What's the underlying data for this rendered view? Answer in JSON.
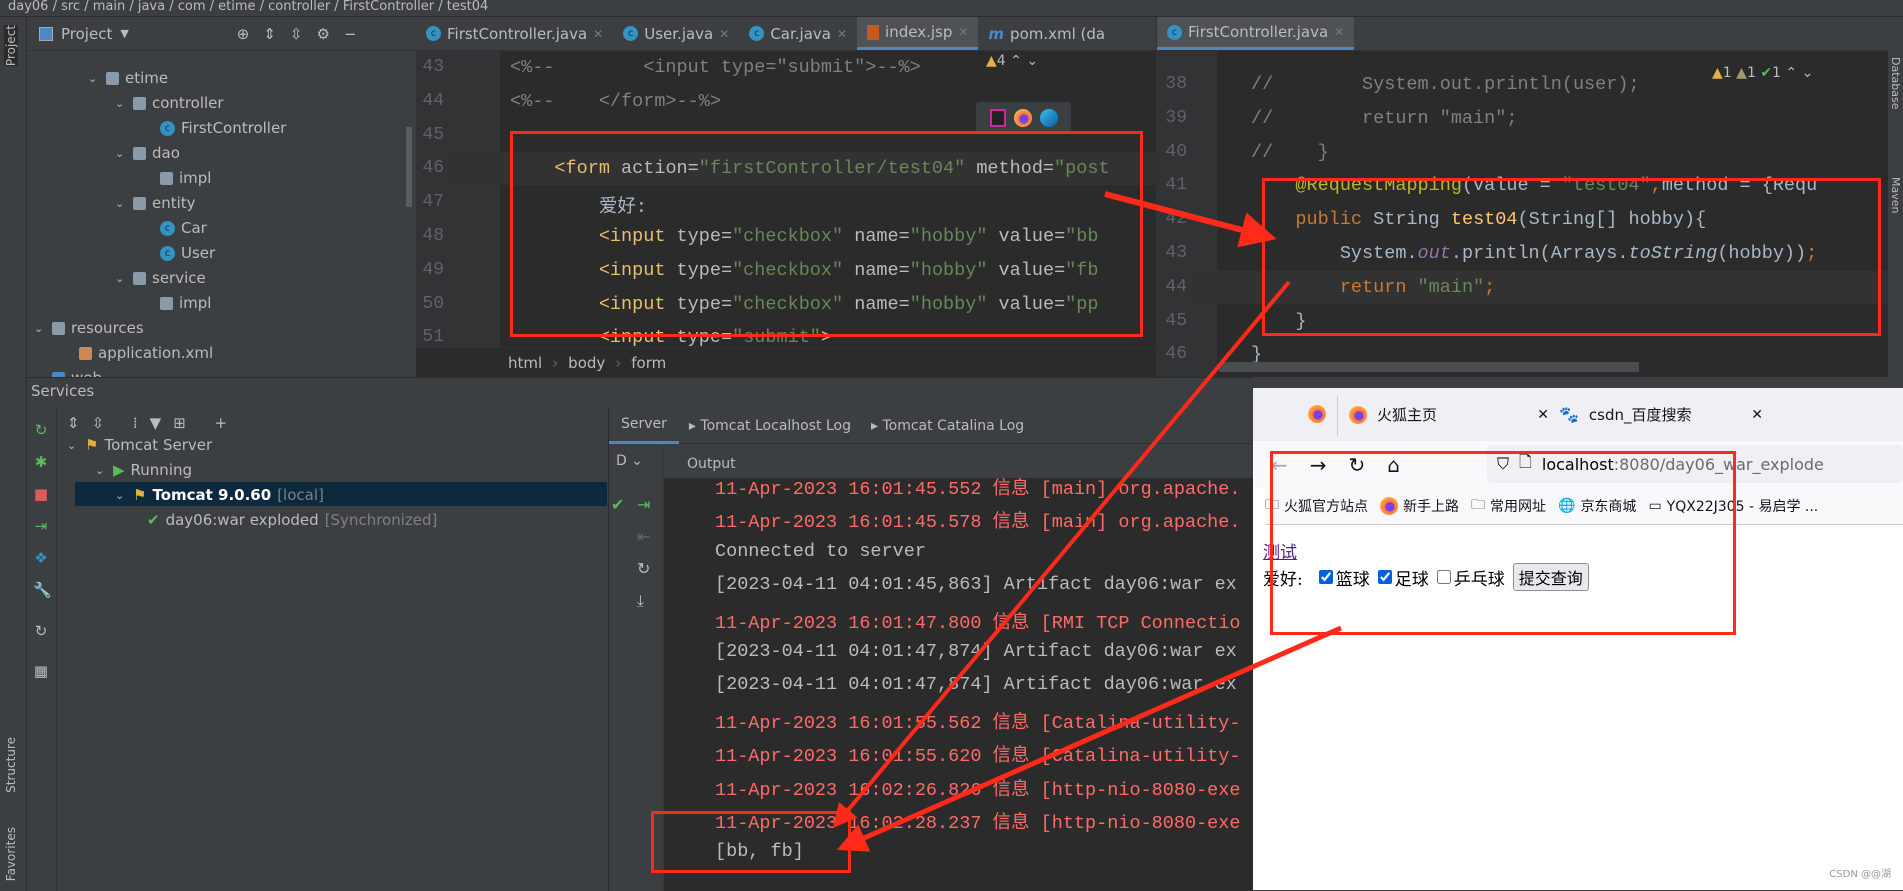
{
  "breadcrumb": "day06 / src / main / java / com / etime / controller / FirstController / test04",
  "left_strip": {
    "project": "Project",
    "structure": "Structure",
    "favorites": "Favorites"
  },
  "right_strip": {
    "database": "Database",
    "maven": "Maven"
  },
  "run_config": "Tomcat 9.0.60",
  "project_panel": {
    "title": "Project",
    "tree": [
      {
        "label": "etime",
        "type": "package",
        "level": 3,
        "expanded": true
      },
      {
        "label": "controller",
        "type": "package",
        "level": 4,
        "expanded": true
      },
      {
        "label": "FirstController",
        "type": "class",
        "level": 5
      },
      {
        "label": "dao",
        "type": "package",
        "level": 4,
        "expanded": true
      },
      {
        "label": "impl",
        "type": "package",
        "level": 5
      },
      {
        "label": "entity",
        "type": "package",
        "level": 4,
        "expanded": true
      },
      {
        "label": "Car",
        "type": "class",
        "level": 5
      },
      {
        "label": "User",
        "type": "class",
        "level": 5
      },
      {
        "label": "service",
        "type": "package",
        "level": 4,
        "expanded": true
      },
      {
        "label": "impl",
        "type": "package",
        "level": 5
      },
      {
        "label": "resources",
        "type": "folder",
        "level": 1,
        "expanded": true
      },
      {
        "label": "application.xml",
        "type": "xml",
        "level": 2
      },
      {
        "label": "web",
        "type": "folder",
        "level": 1,
        "expanded": true
      }
    ]
  },
  "editor_left": {
    "tabs": [
      {
        "label": "FirstController.java",
        "icon": "class-icon",
        "active": false
      },
      {
        "label": "User.java",
        "icon": "class-icon",
        "active": false
      },
      {
        "label": "Car.java",
        "icon": "class-icon",
        "active": false
      },
      {
        "label": "index.jsp",
        "icon": "jsp-icon",
        "active": true
      },
      {
        "label": "pom.xml (da",
        "icon": "maven-icon",
        "active": false
      }
    ],
    "warnings": "4",
    "lines": [
      {
        "n": "43",
        "tokens": [
          [
            "<%--        <input type=\"submit\">--%>",
            "com"
          ]
        ]
      },
      {
        "n": "44",
        "tokens": [
          [
            "<%--    </form>--%>",
            "com"
          ]
        ]
      },
      {
        "n": "45",
        "tokens": []
      },
      {
        "n": "46",
        "tokens": [
          [
            "    ",
            "txt"
          ],
          [
            "<form",
            "tag"
          ],
          [
            " action=",
            "attr"
          ],
          [
            "\"firstController/test04\"",
            "val"
          ],
          [
            " method=",
            "attr"
          ],
          [
            "\"post",
            "val"
          ]
        ]
      },
      {
        "n": "47",
        "tokens": [
          [
            "        爱好:",
            "txt"
          ]
        ]
      },
      {
        "n": "48",
        "tokens": [
          [
            "        ",
            "txt"
          ],
          [
            "<input",
            "tag"
          ],
          [
            " type=",
            "attr"
          ],
          [
            "\"checkbox\"",
            "val"
          ],
          [
            " name=",
            "attr"
          ],
          [
            "\"hobby\"",
            "val"
          ],
          [
            " value=",
            "attr"
          ],
          [
            "\"bb",
            "val"
          ]
        ]
      },
      {
        "n": "49",
        "tokens": [
          [
            "        ",
            "txt"
          ],
          [
            "<input",
            "tag"
          ],
          [
            " type=",
            "attr"
          ],
          [
            "\"checkbox\"",
            "val"
          ],
          [
            " name=",
            "attr"
          ],
          [
            "\"hobby\"",
            "val"
          ],
          [
            " value=",
            "attr"
          ],
          [
            "\"fb",
            "val"
          ]
        ]
      },
      {
        "n": "50",
        "tokens": [
          [
            "        ",
            "txt"
          ],
          [
            "<input",
            "tag"
          ],
          [
            " type=",
            "attr"
          ],
          [
            "\"checkbox\"",
            "val"
          ],
          [
            " name=",
            "attr"
          ],
          [
            "\"hobby\"",
            "val"
          ],
          [
            " value=",
            "attr"
          ],
          [
            "\"pp",
            "val"
          ]
        ]
      },
      {
        "n": "51",
        "tokens": [
          [
            "        ",
            "txt"
          ],
          [
            "<input",
            "tag"
          ],
          [
            " type=",
            "attr"
          ],
          [
            "\"submit\"",
            "val"
          ],
          [
            ">",
            "tag"
          ]
        ]
      }
    ],
    "breadcrumbs": [
      "html",
      "body",
      "form"
    ]
  },
  "editor_right": {
    "tabs": [
      {
        "label": "FirstController.java",
        "icon": "class-icon",
        "active": true
      }
    ],
    "inspections": {
      "warnings": "1",
      "weak_warnings": "1",
      "typos": "1"
    },
    "lines": [
      {
        "n": "38",
        "tokens": [
          [
            "//        System.out.println(user);",
            "com"
          ]
        ]
      },
      {
        "n": "39",
        "tokens": [
          [
            "//        return \"main\";",
            "com"
          ]
        ]
      },
      {
        "n": "40",
        "tokens": [
          [
            "//    }",
            "com"
          ]
        ]
      },
      {
        "n": "41",
        "tokens": [
          [
            "    ",
            "txt"
          ],
          [
            "@RequestMapping",
            "ann"
          ],
          [
            "(value = ",
            "txt"
          ],
          [
            "\"test04\"",
            "str"
          ],
          [
            ",",
            "kw"
          ],
          [
            "method = {Requ",
            "txt"
          ]
        ]
      },
      {
        "n": "42",
        "tokens": [
          [
            "    ",
            "txt"
          ],
          [
            "public ",
            "kw"
          ],
          [
            "String ",
            "txt"
          ],
          [
            "test04",
            "fn"
          ],
          [
            "(String[] hobby){",
            "txt"
          ]
        ]
      },
      {
        "n": "43",
        "tokens": [
          [
            "        System.",
            "txt"
          ],
          [
            "out",
            "field"
          ],
          [
            ".println(Arrays.",
            "txt"
          ],
          [
            "toString",
            "it"
          ],
          [
            "(hobby))",
            "txt"
          ],
          [
            ";",
            "kw"
          ]
        ]
      },
      {
        "n": "44",
        "tokens": [
          [
            "        ",
            "txt"
          ],
          [
            "return ",
            "kw"
          ],
          [
            "\"main\"",
            "str"
          ],
          [
            ";",
            "kw"
          ]
        ]
      },
      {
        "n": "45",
        "tokens": [
          [
            "    }",
            "txt"
          ]
        ]
      },
      {
        "n": "46",
        "tokens": [
          [
            "}",
            "txt"
          ]
        ]
      }
    ]
  },
  "services": {
    "title": "Services",
    "tree": [
      {
        "label": "Tomcat Server",
        "extra": ""
      },
      {
        "label": "Running",
        "extra": ""
      },
      {
        "label": "Tomcat 9.0.60",
        "extra": "[local]"
      },
      {
        "label": "day06:war exploded",
        "extra": "[Synchronized]"
      }
    ],
    "tabs": [
      "Server",
      "Tomcat Localhost Log",
      "Tomcat Catalina Log"
    ],
    "deploy_label": "D",
    "output_label": "Output",
    "output": [
      {
        "text": "11-Apr-2023 16:01:45.552 信息 [main] org.apache.",
        "level": "red"
      },
      {
        "text": "11-Apr-2023 16:01:45.578 信息 [main] org.apache.",
        "level": "red"
      },
      {
        "text": "Connected to server",
        "level": "white"
      },
      {
        "text": "[2023-04-11 04:01:45,863] Artifact day06:war ex",
        "level": "white"
      },
      {
        "text": "11-Apr-2023 16:01:47.800 信息 [RMI TCP Connectio",
        "level": "red"
      },
      {
        "text": "[2023-04-11 04:01:47,874] Artifact day06:war ex",
        "level": "white"
      },
      {
        "text": "[2023-04-11 04:01:47,874] Artifact day06:war ex",
        "level": "white"
      },
      {
        "text": "11-Apr-2023 16:01:55.562 信息 [Catalina-utility-",
        "level": "red"
      },
      {
        "text": "11-Apr-2023 16:01:55.620 信息 [Catalina-utility-",
        "level": "red"
      },
      {
        "text": "11-Apr-2023 16:02:26.826 信息 [http-nio-8080-exe",
        "level": "red"
      },
      {
        "text": "11-Apr-2023 16:02:28.237 信息 [http-nio-8080-exe",
        "level": "red"
      },
      {
        "text": "[bb, fb]",
        "level": "white"
      }
    ]
  },
  "browser": {
    "tabs": [
      {
        "label": "火狐主页",
        "icon": "firefox-icon"
      },
      {
        "label": "csdn_百度搜索",
        "icon": "baidu-icon"
      }
    ],
    "url_host": "localhost",
    "url_rest": ":8080/day06_war_explode",
    "bookmarks": [
      {
        "label": "火狐官方站点",
        "icon": "folder-icon"
      },
      {
        "label": "新手上路",
        "icon": "firefox-icon"
      },
      {
        "label": "常用网址",
        "icon": "folder-icon"
      },
      {
        "label": "京东商城",
        "icon": "globe-icon"
      },
      {
        "label": "YQX22J305 - 易启学 ...",
        "icon": "page-icon"
      }
    ],
    "page": {
      "link": "测试",
      "hobby_label": "爱好:",
      "checkboxes": [
        {
          "label": "篮球",
          "checked": true
        },
        {
          "label": "足球",
          "checked": true
        },
        {
          "label": "乒乓球",
          "checked": false
        }
      ],
      "submit": "提交查询"
    },
    "watermark": "CSDN @@湖"
  },
  "colors": {
    "annotation_red": "#ff2a1a",
    "log_red": "#ff6b68",
    "selection": "#0d293e",
    "checkbox_blue": "#0060df"
  }
}
